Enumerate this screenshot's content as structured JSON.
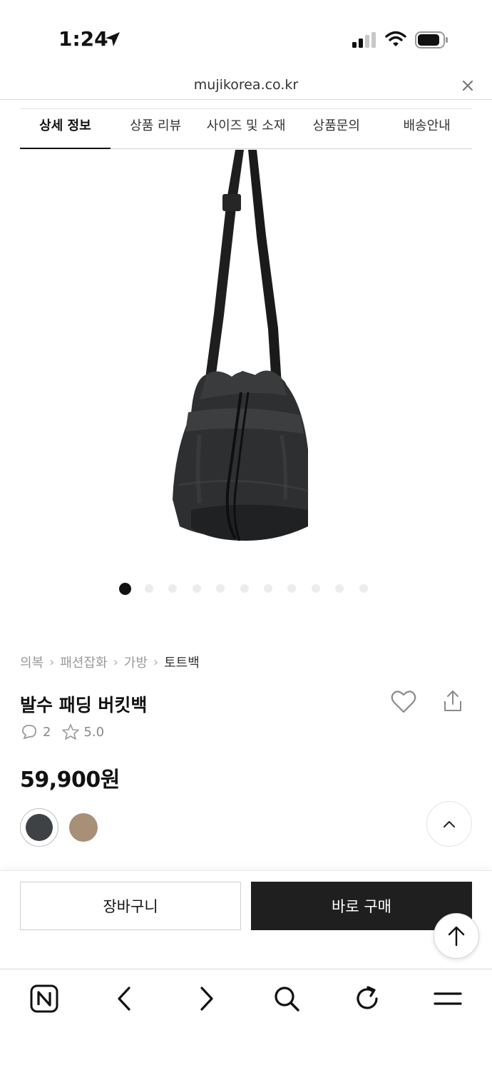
{
  "status_bar": {
    "time": "1:24"
  },
  "browser": {
    "url": "mujikorea.co.kr"
  },
  "tabs": [
    {
      "label": "상세 정보",
      "active": true
    },
    {
      "label": "상품 리뷰",
      "active": false
    },
    {
      "label": "사이즈 및 소재",
      "active": false
    },
    {
      "label": "상품문의",
      "active": false
    },
    {
      "label": "배송안내",
      "active": false
    }
  ],
  "carousel": {
    "total": 11,
    "current": 1
  },
  "breadcrumb": [
    "의복",
    "패션잡화",
    "가방",
    "토트백"
  ],
  "product": {
    "title": "발수 패딩 버킷백",
    "comment_count": "2",
    "rating": "5.0",
    "price": "59,900원",
    "colors": [
      "#3f4244",
      "#a88f77"
    ]
  },
  "actions": {
    "cart_label": "장바구니",
    "buy_label": "바로 구매"
  },
  "icons": {
    "status": [
      "location-arrow-icon",
      "signal-icon",
      "wifi-icon",
      "battery-icon"
    ],
    "toolbar": [
      "naver-n-icon",
      "back-icon",
      "forward-icon",
      "search-icon",
      "reload-icon",
      "menu-icon"
    ]
  }
}
